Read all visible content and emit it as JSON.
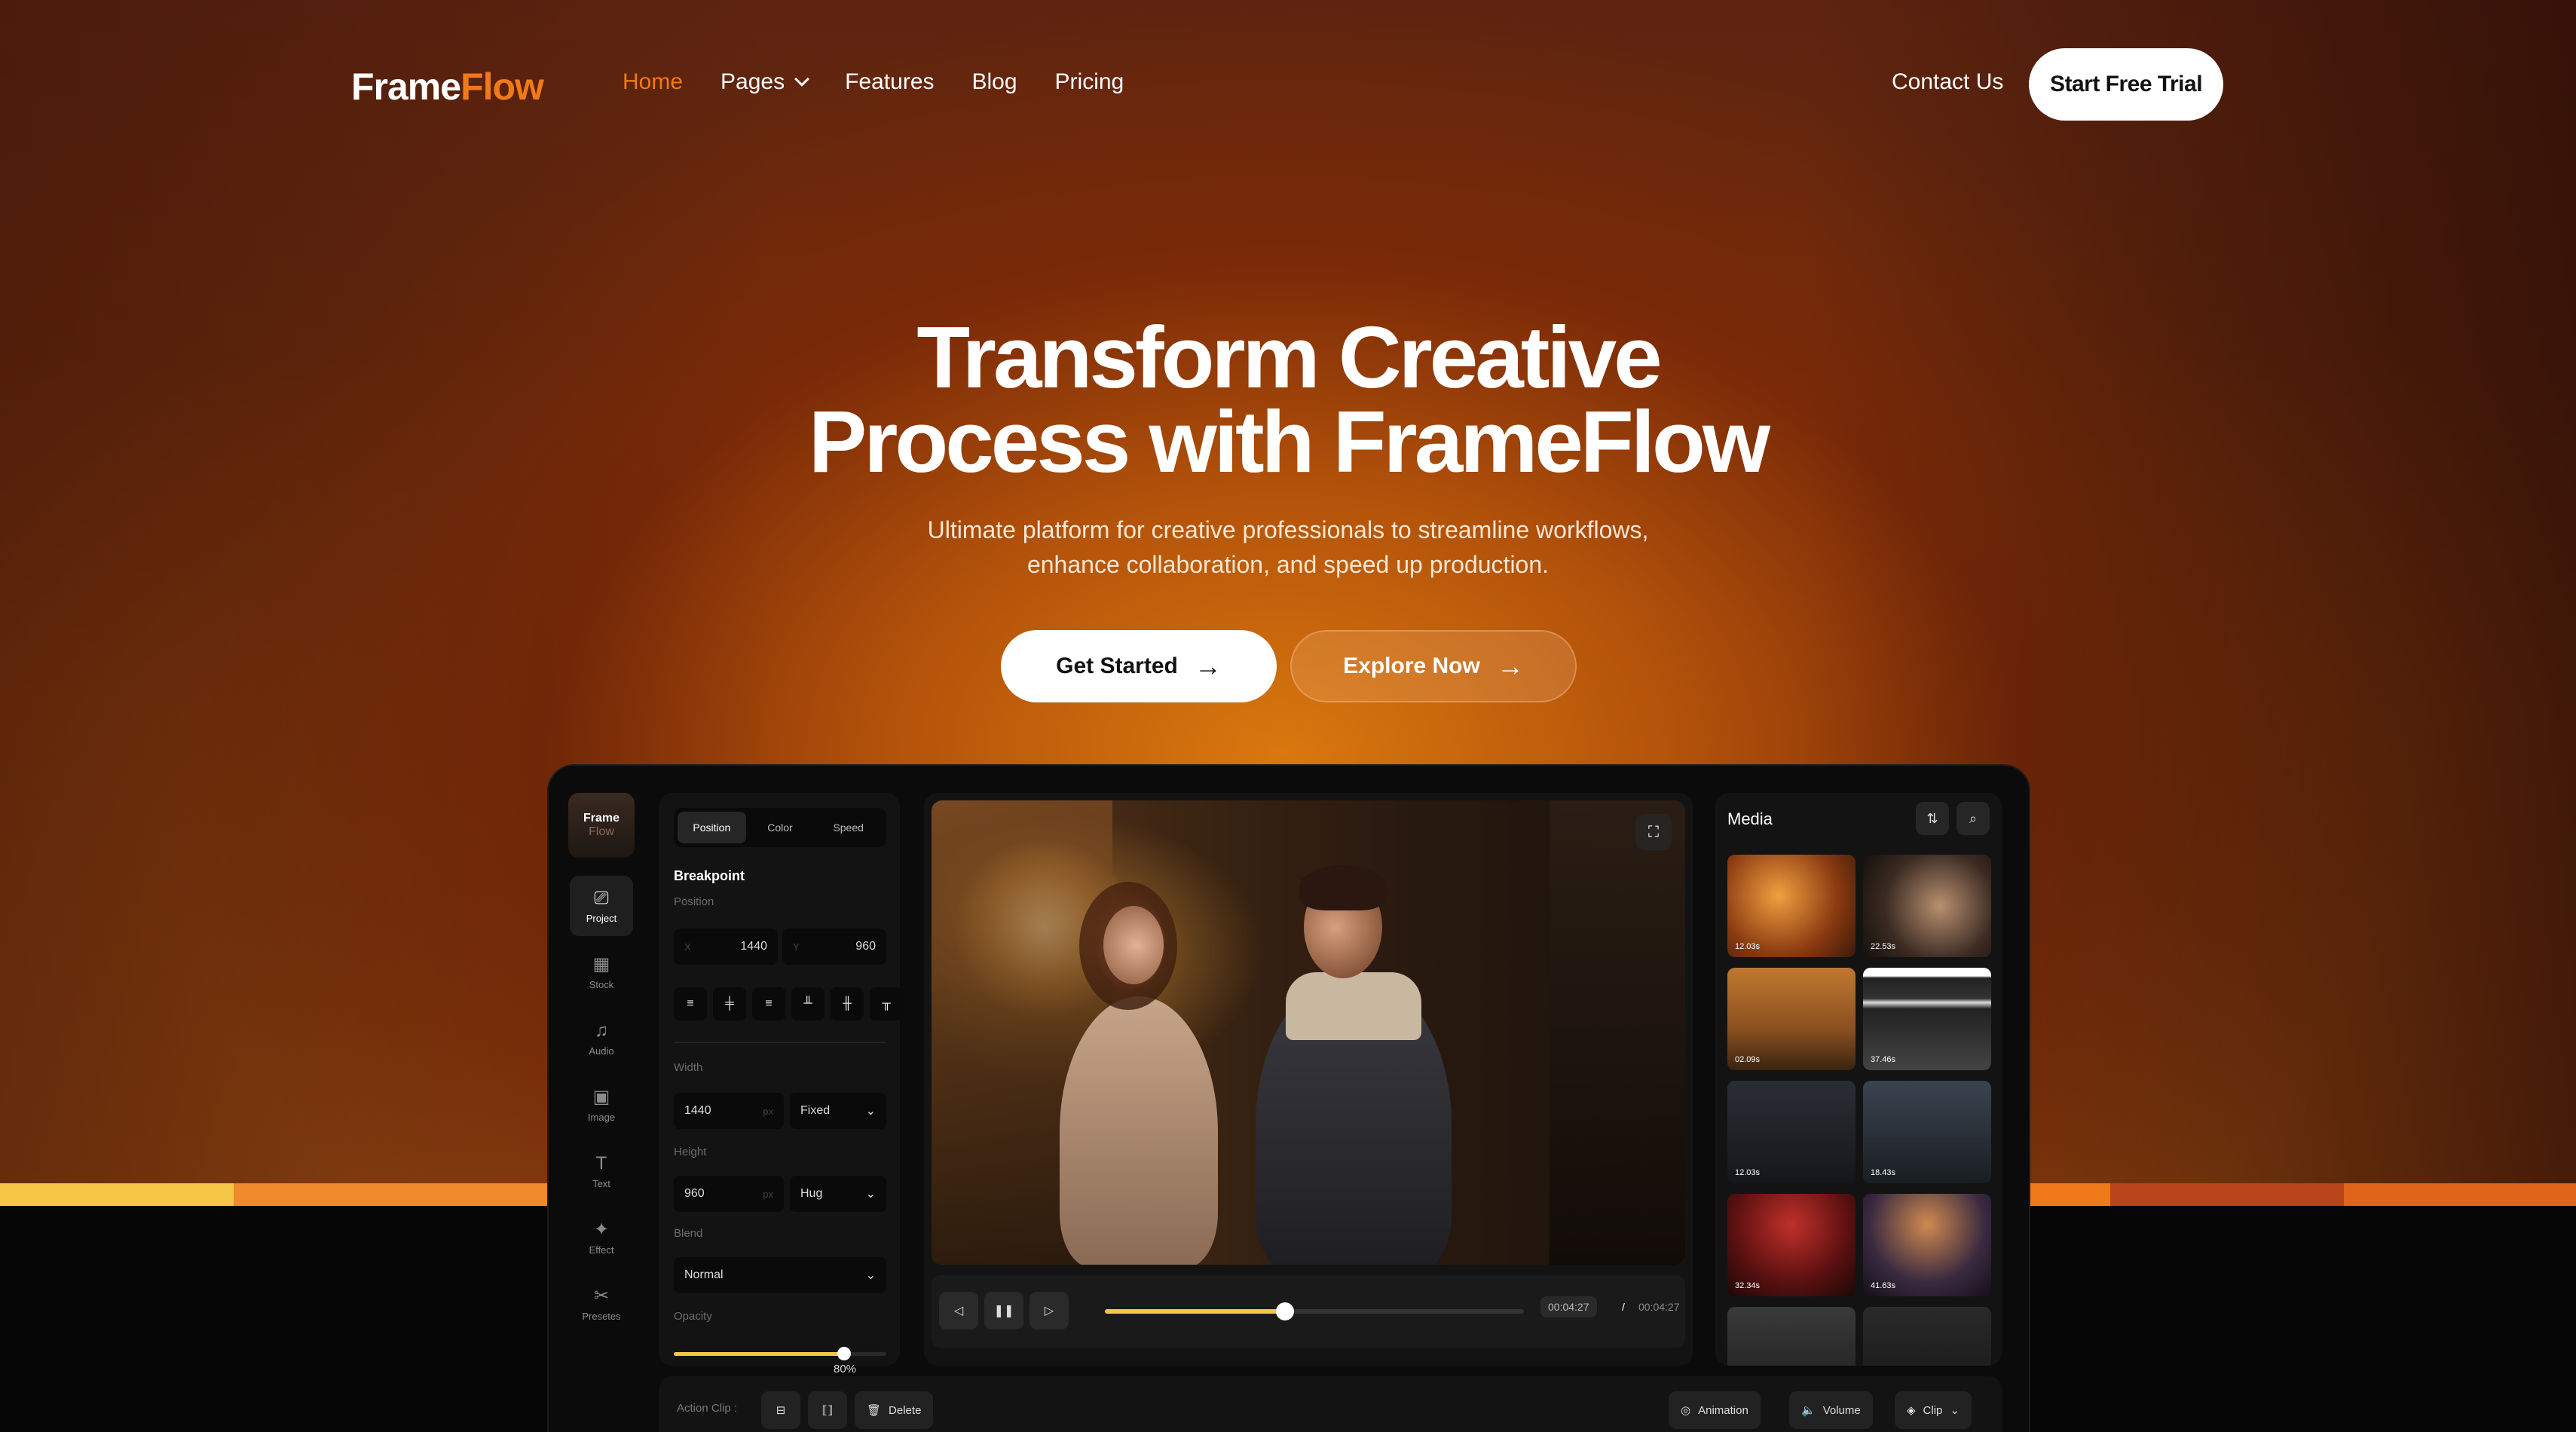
{
  "brand": {
    "part1": "Frame",
    "part2": "Flow"
  },
  "nav": {
    "items": [
      {
        "label": "Home",
        "active": true
      },
      {
        "label": "Pages",
        "dropdown": true
      },
      {
        "label": "Features"
      },
      {
        "label": "Blog"
      },
      {
        "label": "Pricing"
      }
    ],
    "contact": "Contact Us",
    "cta": "Start Free Trial"
  },
  "hero": {
    "title_line1": "Transform Creative",
    "title_line2": "Process with FrameFlow",
    "subtitle_line1": "Ultimate platform for creative professionals to streamline workflows,",
    "subtitle_line2": "enhance collaboration, and speed up production.",
    "primary_button": "Get Started",
    "secondary_button": "Explore Now"
  },
  "colors": {
    "accent": "#f07a1a",
    "highlight": "#f6c646",
    "stripe_yellow": "#f6c646",
    "stripe_orange": "#f08a2a",
    "stripe_red": "#c8501a"
  },
  "app": {
    "rail_logo": {
      "line1": "Frame",
      "line2": "Flow"
    },
    "rail": [
      {
        "label": "Project",
        "icon": "film-icon",
        "active": true
      },
      {
        "label": "Stock",
        "icon": "grid-film-icon"
      },
      {
        "label": "Audio",
        "icon": "audio-icon"
      },
      {
        "label": "Image",
        "icon": "image-icon"
      },
      {
        "label": "Text",
        "icon": "text-icon"
      },
      {
        "label": "Effect",
        "icon": "effect-icon"
      },
      {
        "label": "Presetes",
        "icon": "presets-icon"
      }
    ],
    "properties": {
      "tabs": [
        "Position",
        "Color",
        "Speed"
      ],
      "section": "Breakpoint",
      "position_label": "Position",
      "x_prefix": "X",
      "x_value": "1440",
      "y_prefix": "Y",
      "y_value": "960",
      "width_label": "Width",
      "width_value": "1440",
      "width_unit": "px",
      "width_mode": "Fixed",
      "height_label": "Height",
      "height_value": "960",
      "height_unit": "px",
      "height_mode": "Hug",
      "blend_label": "Blend",
      "blend_value": "Normal",
      "opacity_label": "Opacity",
      "opacity_value": "80%",
      "opacity_fraction": 0.8
    },
    "player": {
      "current_time": "00:04:27",
      "separator": "/",
      "total_time": "00:04:27",
      "progress_fraction": 0.43
    },
    "media": {
      "title": "Media",
      "items": [
        {
          "duration": "12.03s"
        },
        {
          "duration": "22.53s"
        },
        {
          "duration": "02.09s"
        },
        {
          "duration": "37.46s"
        },
        {
          "duration": "12.03s"
        },
        {
          "duration": "18.43s"
        },
        {
          "duration": "32.34s"
        },
        {
          "duration": "41.63s"
        }
      ]
    },
    "action_bar": {
      "label": "Action Clip :",
      "delete": "Delete",
      "animation": "Animation",
      "volume": "Volume",
      "clip": "Clip"
    }
  }
}
